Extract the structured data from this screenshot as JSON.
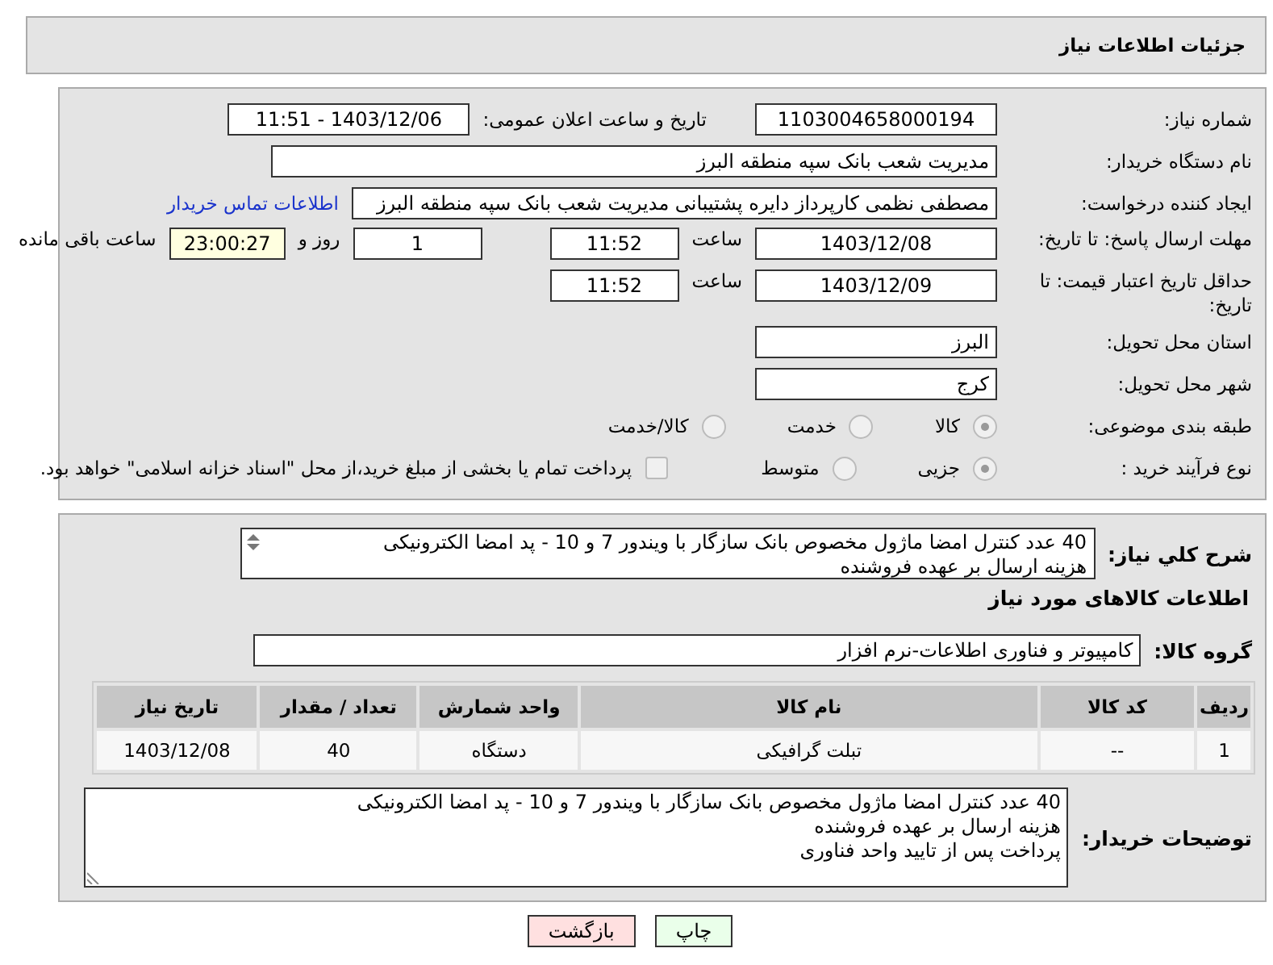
{
  "header": {
    "title": "جزئیات اطلاعات نیاز"
  },
  "form": {
    "need_number": {
      "label": "شماره نیاز:",
      "value": "1103004658000194"
    },
    "announce": {
      "label": "تاریخ و ساعت اعلان عمومی:",
      "value": "1403/12/06 - 11:51"
    },
    "buyer": {
      "label": "نام دستگاه خریدار:",
      "value": "مدیریت شعب بانک سپه منطقه البرز"
    },
    "creator": {
      "label": "ایجاد کننده درخواست:",
      "value": "مصطفی نظمی کارپرداز دایره پشتیبانی مدیریت شعب بانک سپه منطقه البرز",
      "link": "اطلاعات تماس خریدار"
    },
    "deadline": {
      "label": "مهلت ارسال پاسخ: تا تاریخ:",
      "date": "1403/12/08",
      "time_label": "ساعت",
      "time": "11:52",
      "days": "1",
      "days_label": "روز و",
      "remaining": "23:00:27",
      "remaining_label": "ساعت باقی مانده"
    },
    "validity": {
      "label": "حداقل تاریخ اعتبار قیمت: تا تاریخ:",
      "date": "1403/12/09",
      "time_label": "ساعت",
      "time": "11:52"
    },
    "province": {
      "label": "استان محل تحویل:",
      "value": "البرز"
    },
    "city": {
      "label": "شهر محل تحویل:",
      "value": "کرج"
    },
    "category": {
      "label": "طبقه بندی موضوعی:",
      "options": [
        {
          "label": "کالا",
          "selected": true
        },
        {
          "label": "خدمت",
          "selected": false
        },
        {
          "label": "کالا/خدمت",
          "selected": false
        }
      ]
    },
    "process": {
      "label": "نوع فرآیند خرید :",
      "options": [
        {
          "label": "جزیی",
          "selected": true
        },
        {
          "label": "متوسط",
          "selected": false
        }
      ],
      "treasury": {
        "checked": false,
        "label": "پرداخت تمام یا بخشی از مبلغ خرید،از محل \"اسناد خزانه اسلامی\" خواهد بود."
      }
    }
  },
  "details": {
    "description": {
      "label": "شرح کلي نياز:",
      "lines": [
        "40 عدد کنترل امضا ماژول مخصوص بانک سازگار با ویندور 7 و 10 - پد امضا الکترونیکی",
        "هزینه ارسال بر عهده فروشنده"
      ]
    },
    "goods_title": "اطلاعات کالاهای مورد نیاز",
    "group": {
      "label": "گروه کالا:",
      "value": "کامپیوتر و فناوری اطلاعات-نرم افزار"
    },
    "table": {
      "columns": [
        "ردیف",
        "کد کالا",
        "نام کالا",
        "واحد شمارش",
        "تعداد / مقدار",
        "تاریخ نیاز"
      ],
      "rows": [
        [
          "1",
          "--",
          "تبلت گرافیکی",
          "دستگاه",
          "40",
          "1403/12/08"
        ]
      ]
    },
    "notes": {
      "label": "توضیحات خریدار:",
      "lines": [
        "40 عدد کنترل امضا ماژول مخصوص بانک سازگار با ویندور 7 و 10 - پد امضا الکترونیکی",
        "هزینه ارسال بر عهده فروشنده",
        "پرداخت پس از تایید واحد فناوری"
      ]
    }
  },
  "buttons": [
    {
      "label": "چاپ",
      "kind": "print"
    },
    {
      "label": "بازگشت",
      "kind": "back"
    }
  ]
}
